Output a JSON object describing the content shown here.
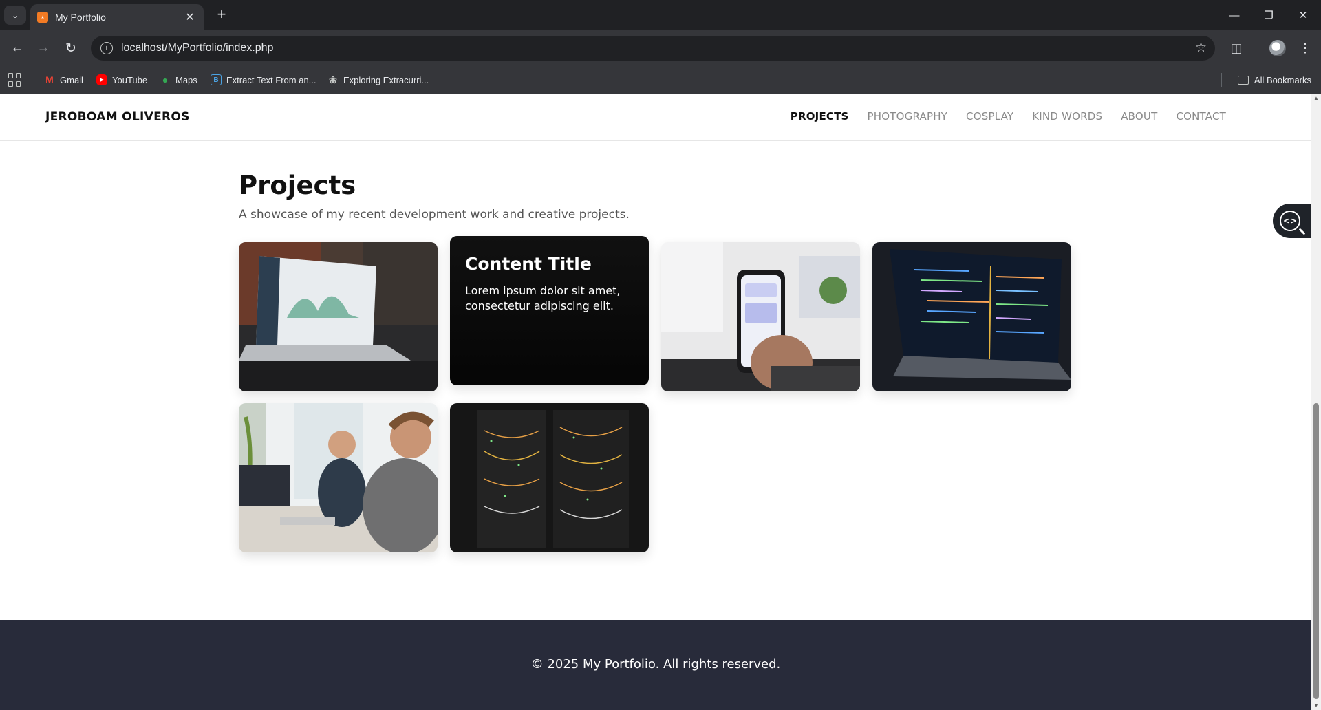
{
  "browser": {
    "tab_title": "My Portfolio",
    "url": "localhost/MyPortfolio/index.php",
    "bookmarks": [
      {
        "label": "Gmail",
        "icon": "gmail-icon"
      },
      {
        "label": "YouTube",
        "icon": "youtube-icon"
      },
      {
        "label": "Maps",
        "icon": "maps-icon"
      },
      {
        "label": "Extract Text From an...",
        "icon": "bookmark-b-icon"
      },
      {
        "label": "Exploring Extracurri...",
        "icon": "openai-icon"
      }
    ],
    "all_bookmarks": "All Bookmarks"
  },
  "site": {
    "brand": "JEROBOAM OLIVEROS",
    "nav": [
      {
        "label": "PROJECTS",
        "active": true
      },
      {
        "label": "PHOTOGRAPHY",
        "active": false
      },
      {
        "label": "COSPLAY",
        "active": false
      },
      {
        "label": "KIND WORDS",
        "active": false
      },
      {
        "label": "ABOUT",
        "active": false
      },
      {
        "label": "CONTACT",
        "active": false
      }
    ],
    "title": "Projects",
    "subtitle": "A showcase of my recent development work and creative projects.",
    "hover_card": {
      "title": "Content Title",
      "text": "Lorem ipsum dolor sit amet, consectetur adipiscing elit."
    },
    "footer": "© 2025 My Portfolio. All rights reserved."
  },
  "colors": {
    "footer_bg": "#282b3a",
    "nav_active": "#111111",
    "nav_inactive": "#8a8a8a"
  }
}
